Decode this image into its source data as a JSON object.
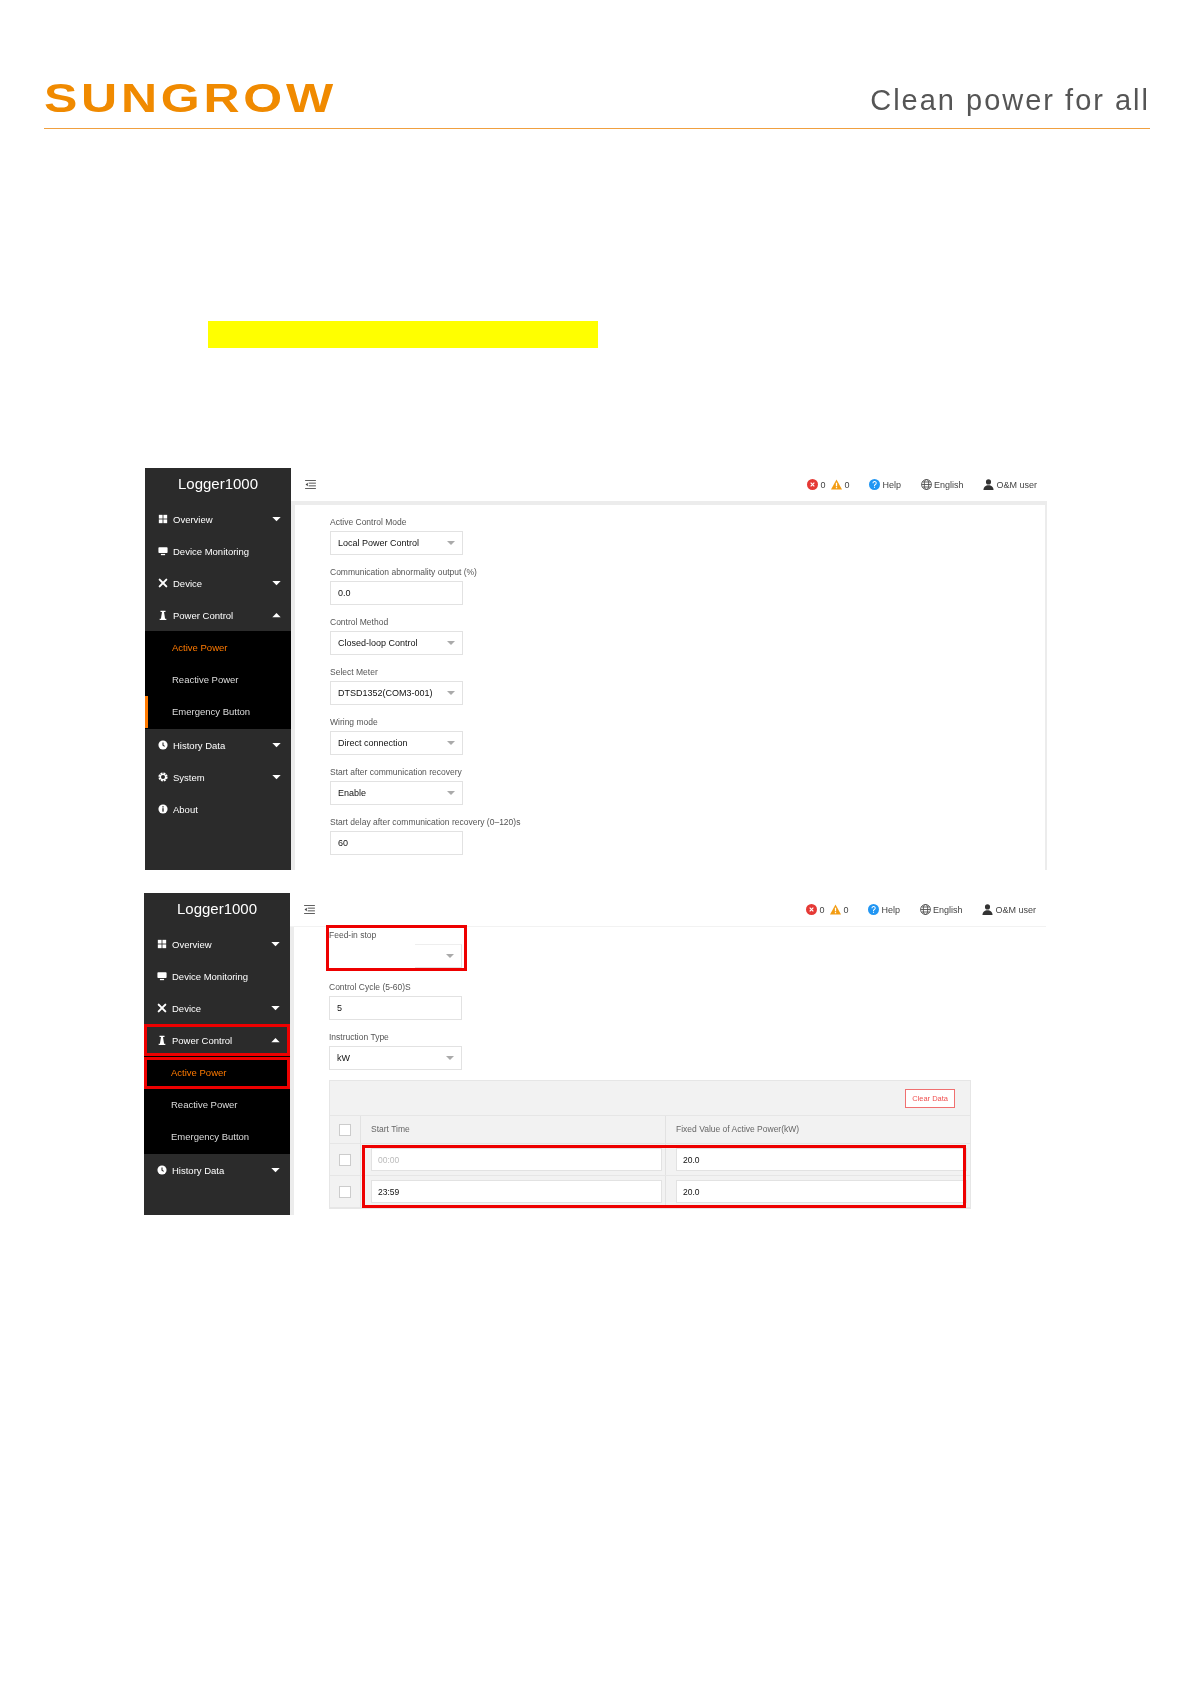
{
  "header": {
    "logo": "SUNGROW",
    "tagline": "Clean power for all"
  },
  "screens": [
    {
      "app_title": "Logger1000",
      "topbar": {
        "errors": "0",
        "warnings": "0",
        "help": "Help",
        "language": "English",
        "user": "O&M user"
      },
      "sidebar": [
        {
          "label": "Overview",
          "expanded": false,
          "highlighted": false
        },
        {
          "label": "Device Monitoring",
          "highlighted": false
        },
        {
          "label": "Device",
          "expanded": false,
          "highlighted": false
        },
        {
          "label": "Power Control",
          "expanded": true,
          "highlighted": false,
          "children": [
            {
              "label": "Active Power",
              "selected": true,
              "highlighted": false,
              "marked": false
            },
            {
              "label": "Reactive Power",
              "selected": false,
              "highlighted": false,
              "marked": false
            },
            {
              "label": "Emergency Button",
              "selected": false,
              "highlighted": false,
              "marked": true
            }
          ]
        },
        {
          "label": "History Data",
          "expanded": false,
          "highlighted": false
        },
        {
          "label": "System",
          "expanded": false,
          "highlighted": false
        },
        {
          "label": "About",
          "highlighted": false
        }
      ],
      "fields": [
        {
          "kind": "select",
          "label": "Active Control Mode",
          "value": "Local Power Control",
          "highlighted": false
        },
        {
          "kind": "input",
          "label": "Communication abnormality output (%)",
          "value": "0.0",
          "highlighted": false
        },
        {
          "kind": "select",
          "label": "Control Method",
          "value": "Closed-loop Control",
          "highlighted": false
        },
        {
          "kind": "select",
          "label": "Select Meter",
          "value": "DTSD1352(COM3-001)",
          "highlighted": false
        },
        {
          "kind": "select",
          "label": "Wiring mode",
          "value": "Direct connection",
          "highlighted": false
        },
        {
          "kind": "select",
          "label": "Start after communication recovery",
          "value": "Enable",
          "highlighted": false
        },
        {
          "kind": "input",
          "label": "Start delay after communication recovery (0–120)s",
          "value": "60",
          "highlighted": false
        }
      ]
    },
    {
      "app_title": "Logger1000",
      "topbar": {
        "errors": "0",
        "warnings": "0",
        "help": "Help",
        "language": "English",
        "user": "O&M user"
      },
      "sidebar": [
        {
          "label": "Overview",
          "expanded": false,
          "highlighted": false
        },
        {
          "label": "Device Monitoring",
          "highlighted": false
        },
        {
          "label": "Device",
          "expanded": false,
          "highlighted": false
        },
        {
          "label": "Power Control",
          "expanded": true,
          "highlighted": true,
          "children": [
            {
              "label": "Active Power",
              "selected": true,
              "highlighted": true,
              "marked": false
            },
            {
              "label": "Reactive Power",
              "selected": false,
              "highlighted": false,
              "marked": false
            },
            {
              "label": "Emergency Button",
              "selected": false,
              "highlighted": false,
              "marked": false
            }
          ]
        },
        {
          "label": "History Data",
          "expanded": false,
          "highlighted": false
        }
      ],
      "fields": [
        {
          "kind": "select-partial",
          "label": "Feed-in stop",
          "highlighted": true
        },
        {
          "kind": "input",
          "label": "Control Cycle (5-60)S",
          "value": "5",
          "highlighted": false
        },
        {
          "kind": "select",
          "label": "Instruction Type",
          "value": "kW",
          "highlighted": false
        }
      ],
      "table": {
        "button": "Clear Data",
        "columns": [
          "Start Time",
          "Fixed Value of Active Power(kW)"
        ],
        "rows_highlighted": true,
        "all_checked": false,
        "rows": [
          {
            "checked": false,
            "start_placeholder": "00:00",
            "value": "20.0"
          },
          {
            "checked": false,
            "start": "23:59",
            "value": "20.0"
          }
        ]
      }
    }
  ]
}
